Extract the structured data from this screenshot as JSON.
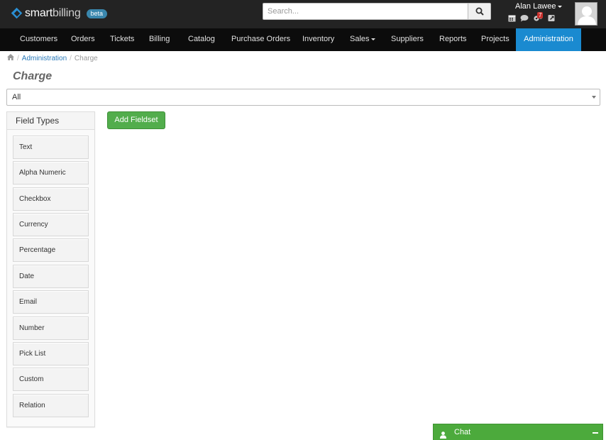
{
  "header": {
    "logo": {
      "bold_text": "smart",
      "light_text": "billing",
      "badge": "beta"
    },
    "search": {
      "placeholder": "Search..."
    },
    "user": {
      "name": "Alan Lawee",
      "notification_count": "7",
      "icons": [
        "calendar-icon",
        "chat-bubble-icon",
        "gears-icon",
        "external-link-icon"
      ]
    }
  },
  "nav": {
    "items": [
      {
        "label": "Customers"
      },
      {
        "label": "Orders"
      },
      {
        "label": "Tickets"
      },
      {
        "label": "Billing"
      },
      {
        "label": "Catalog"
      },
      {
        "label": "Purchase Orders"
      },
      {
        "label": "Inventory"
      },
      {
        "label": "Sales",
        "has_dropdown": true
      },
      {
        "label": "Suppliers"
      },
      {
        "label": "Reports"
      },
      {
        "label": "Projects"
      },
      {
        "label": "Administration",
        "active": true
      }
    ]
  },
  "breadcrumb": {
    "items": [
      "Administration",
      "Charge"
    ]
  },
  "page": {
    "title": "Charge",
    "filter_value": "All",
    "add_fieldset_label": "Add Fieldset"
  },
  "field_types": {
    "title": "Field Types",
    "items": [
      "Text",
      "Alpha Numeric",
      "Checkbox",
      "Currency",
      "Percentage",
      "Date",
      "Email",
      "Number",
      "Pick List",
      "Custom",
      "Relation"
    ]
  },
  "chat": {
    "label": "Chat"
  },
  "colors": {
    "topbar": "#232323",
    "navbar": "#0c0c0c",
    "nav_active": "#1a8ad0",
    "brand_blue": "#2a8fd3",
    "button_green": "#52ad4c",
    "chat_green": "#4caa3c",
    "badge_red": "#c9302c"
  }
}
